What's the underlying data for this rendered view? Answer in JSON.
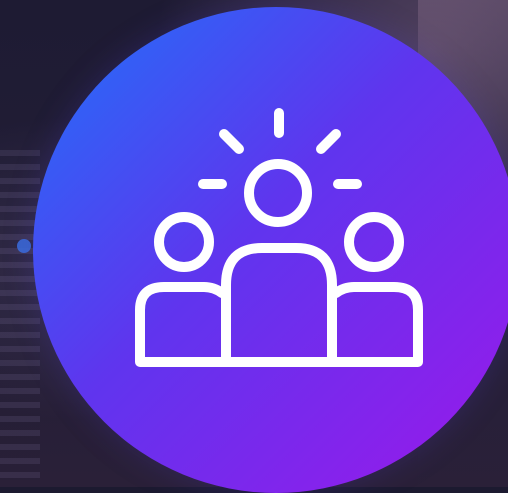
{
  "icon": {
    "name": "team-icon",
    "description_color": "#ffffff"
  },
  "colors": {
    "badge_gradient_start": "#1f72f9",
    "badge_gradient_mid": "#5f35ee",
    "badge_gradient_end": "#9c18ea",
    "accent_dot": "#3a6fe0"
  }
}
